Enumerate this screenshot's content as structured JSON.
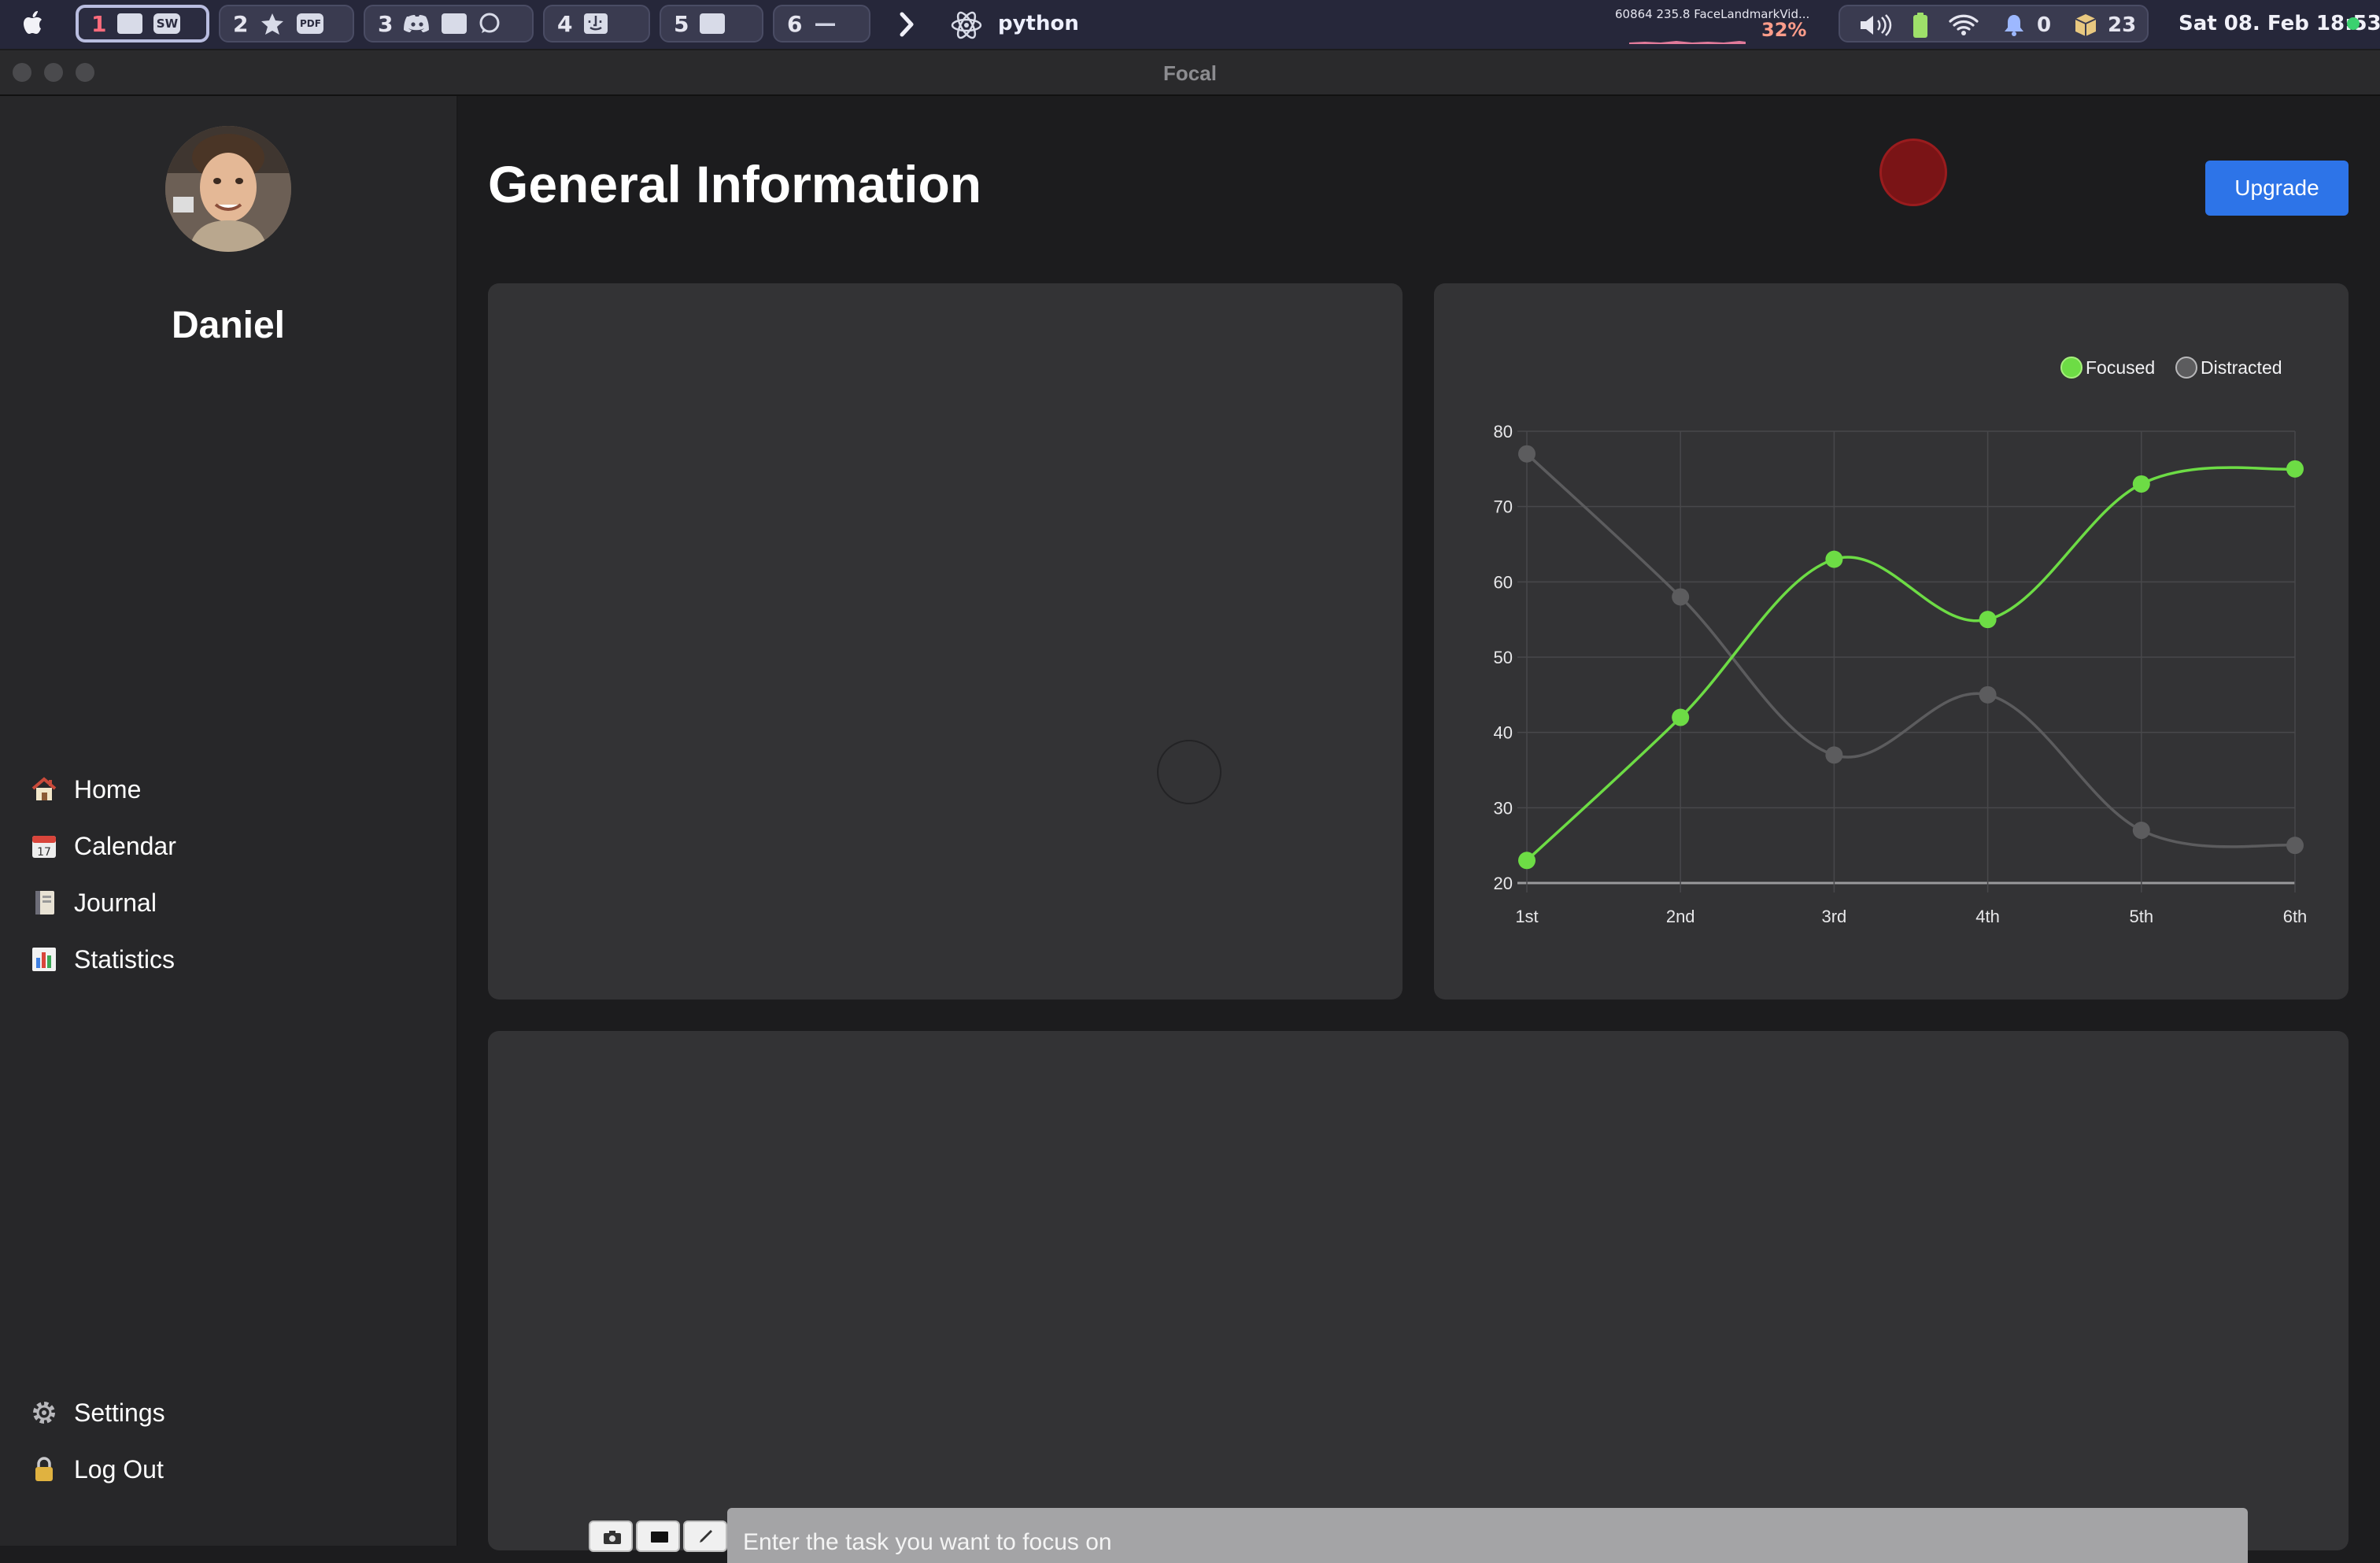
{
  "menubar": {
    "workspaces": [
      {
        "number": "1",
        "icons": [
          "window-icon",
          "sw-app-icon"
        ],
        "sw_label": "SW",
        "active": true
      },
      {
        "number": "2",
        "icons": [
          "star-app-icon",
          "pdf-icon"
        ],
        "pdf_label": "PDF",
        "active": false
      },
      {
        "number": "3",
        "icons": [
          "discord-icon",
          "window-icon",
          "whatsapp-icon"
        ],
        "active": false
      },
      {
        "number": "4",
        "icons": [
          "finder-icon"
        ],
        "active": false
      },
      {
        "number": "5",
        "icons": [
          "window-icon"
        ],
        "active": false
      },
      {
        "number": "6",
        "icons": [
          "dash-icon"
        ],
        "dash": "—",
        "active": false
      }
    ],
    "front_app": "python",
    "process_text": "60864 235.8 FaceLandmarkVid...",
    "cpu_percent": "32%",
    "notifications_count": "0",
    "packages_count": "23",
    "clock": "Sat 08. Feb  18:53"
  },
  "window": {
    "title": "Focal"
  },
  "sidebar": {
    "username": "Daniel",
    "nav": [
      {
        "label": "Home",
        "icon": "house-icon"
      },
      {
        "label": "Calendar",
        "icon": "calendar-icon"
      },
      {
        "label": "Journal",
        "icon": "notebook-icon"
      },
      {
        "label": "Statistics",
        "icon": "bar-chart-icon"
      }
    ],
    "bottom_nav": [
      {
        "label": "Settings",
        "icon": "gear-icon"
      },
      {
        "label": "Log Out",
        "icon": "lock-icon"
      }
    ]
  },
  "main": {
    "title": "General Information",
    "upgrade_label": "Upgrade",
    "task_placeholder": "Enter the task you want to focus on"
  },
  "colors": {
    "focused": "#6ddc45",
    "distracted": "#5c5c5e",
    "accent_button": "#2d74e8",
    "record": "#7a1416"
  },
  "chart_data": {
    "type": "line",
    "categories": [
      "1st",
      "2nd",
      "3rd",
      "4th",
      "5th",
      "6th"
    ],
    "series": [
      {
        "name": "Focused",
        "values": [
          23,
          42,
          63,
          55,
          73,
          75
        ]
      },
      {
        "name": "Distracted",
        "values": [
          77,
          58,
          37,
          45,
          27,
          25
        ]
      }
    ],
    "yticks": [
      "20",
      "30",
      "40",
      "50",
      "60",
      "70",
      "80"
    ],
    "ylim": [
      20,
      80
    ],
    "legend": "top-right",
    "grid": true,
    "smooth": true
  }
}
